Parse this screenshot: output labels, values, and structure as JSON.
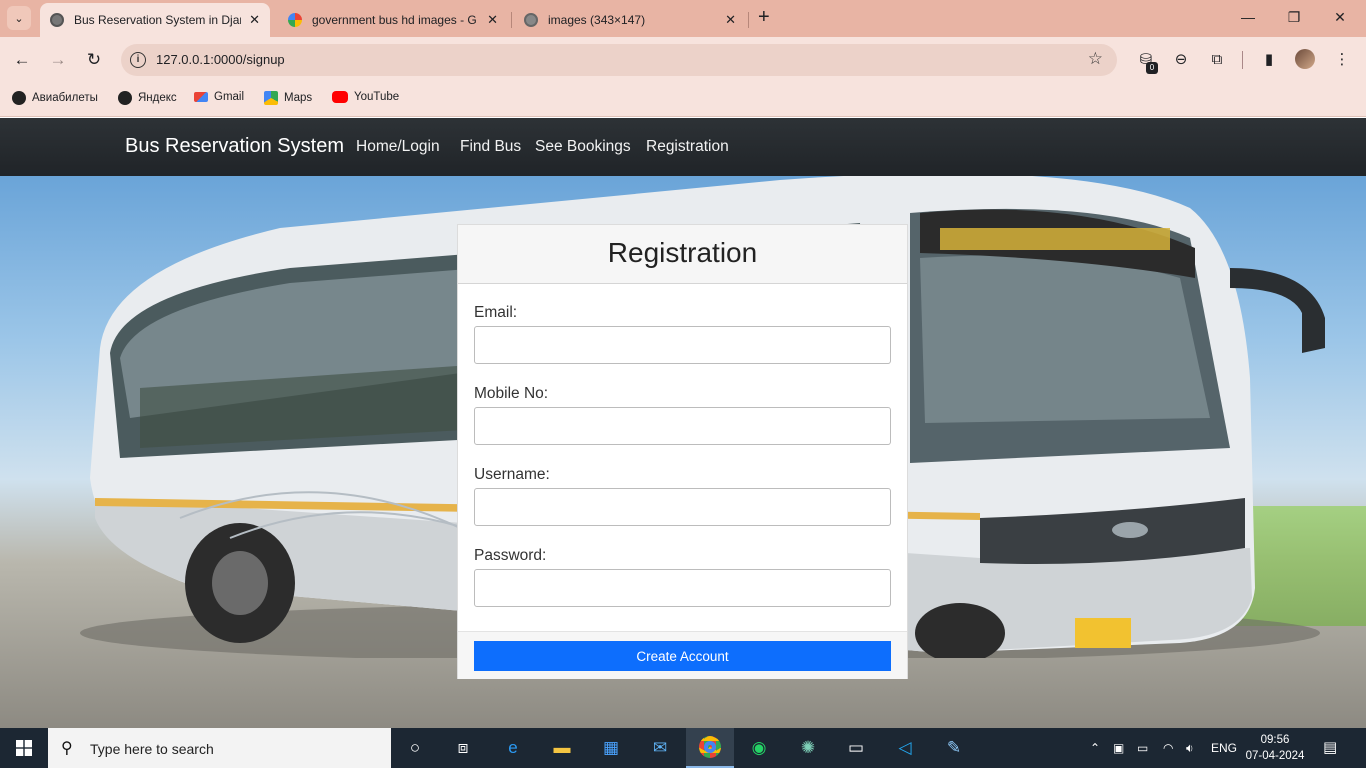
{
  "browser": {
    "tabs": [
      {
        "title": "Bus Reservation System in Djan",
        "active": true
      },
      {
        "title": "government bus hd images - G",
        "active": false
      },
      {
        "title": "images (343×147)",
        "active": false
      }
    ],
    "url": "127.0.0.1:0000/signup",
    "extension_badge": "0",
    "bookmarks": [
      "Авиабилеты",
      "Яндекс",
      "Gmail",
      "Maps",
      "YouTube"
    ]
  },
  "navbar": {
    "brand": "Bus Reservation System",
    "links": [
      "Home/Login",
      "Find Bus",
      "See Bookings",
      "Registration"
    ]
  },
  "form": {
    "title": "Registration",
    "fields": [
      {
        "label": "Email:",
        "value": ""
      },
      {
        "label": "Mobile No:",
        "value": ""
      },
      {
        "label": "Username:",
        "value": ""
      },
      {
        "label": "Password:",
        "value": ""
      }
    ],
    "submit_label": "Create Account"
  },
  "taskbar": {
    "search_placeholder": "Type here to search",
    "language": "ENG",
    "time": "09:56",
    "date": "07-04-2024"
  },
  "colors": {
    "primary_button": "#0d6efd",
    "navbar_bg": "#212529",
    "tab_strip": "#e8b4a4"
  }
}
